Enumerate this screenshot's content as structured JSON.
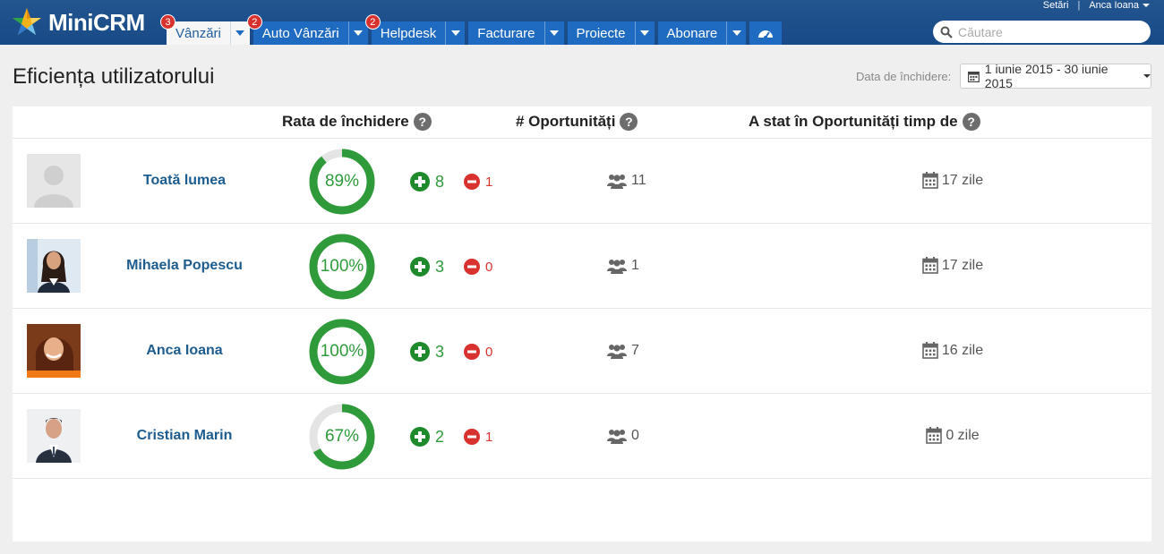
{
  "app": {
    "name": "MiniCRM"
  },
  "topright": {
    "settings": "Setări",
    "user": "Anca Ioana"
  },
  "tabs": [
    {
      "label": "Vânzări",
      "badge": "3"
    },
    {
      "label": "Auto Vânzări",
      "badge": "2"
    },
    {
      "label": "Helpdesk",
      "badge": "2"
    },
    {
      "label": "Facturare",
      "badge": ""
    },
    {
      "label": "Proiecte",
      "badge": ""
    },
    {
      "label": "Abonare",
      "badge": ""
    }
  ],
  "search": {
    "placeholder": "Căutare"
  },
  "page": {
    "title": "Eficiența utilizatorului",
    "date_label": "Data de închidere:",
    "date_range": "1 iunie 2015 - 30 iunie 2015"
  },
  "columns": {
    "closing_rate": "Rata de închidere",
    "opportunities": "# Oportunități",
    "time_in_opportunities": "A stat în Oportunități timp de",
    "help": "?"
  },
  "rows": [
    {
      "name": "Toată lumea",
      "rate": 89,
      "rate_label": "89%",
      "won": "8",
      "lost": "1",
      "opportunities": "11",
      "days": "17 zile"
    },
    {
      "name": "Mihaela Popescu",
      "rate": 100,
      "rate_label": "100%",
      "won": "3",
      "lost": "0",
      "opportunities": "1",
      "days": "17 zile"
    },
    {
      "name": "Anca Ioana",
      "rate": 100,
      "rate_label": "100%",
      "won": "3",
      "lost": "0",
      "opportunities": "7",
      "days": "16 zile"
    },
    {
      "name": "Cristian Marin",
      "rate": 67,
      "rate_label": "67%",
      "won": "2",
      "lost": "1",
      "opportunities": "0",
      "days": "0 zile"
    }
  ],
  "colors": {
    "header": "#1a4e8a",
    "tab": "#1f6bc1",
    "badge": "#d9322e",
    "success": "#2f9a3a",
    "danger": "#d9322e",
    "ring_track": "#e4e4e4",
    "link": "#1d5c8f"
  },
  "icons": {
    "logo": "star-logo-icon",
    "tab_dropdown": "chevron-down-icon",
    "dashboard": "gauge-icon",
    "search": "search-icon",
    "calendar": "calendar-icon",
    "help": "help-circle-icon",
    "won": "plus-circle-icon",
    "lost": "minus-circle-icon",
    "opportunities": "users-icon"
  }
}
